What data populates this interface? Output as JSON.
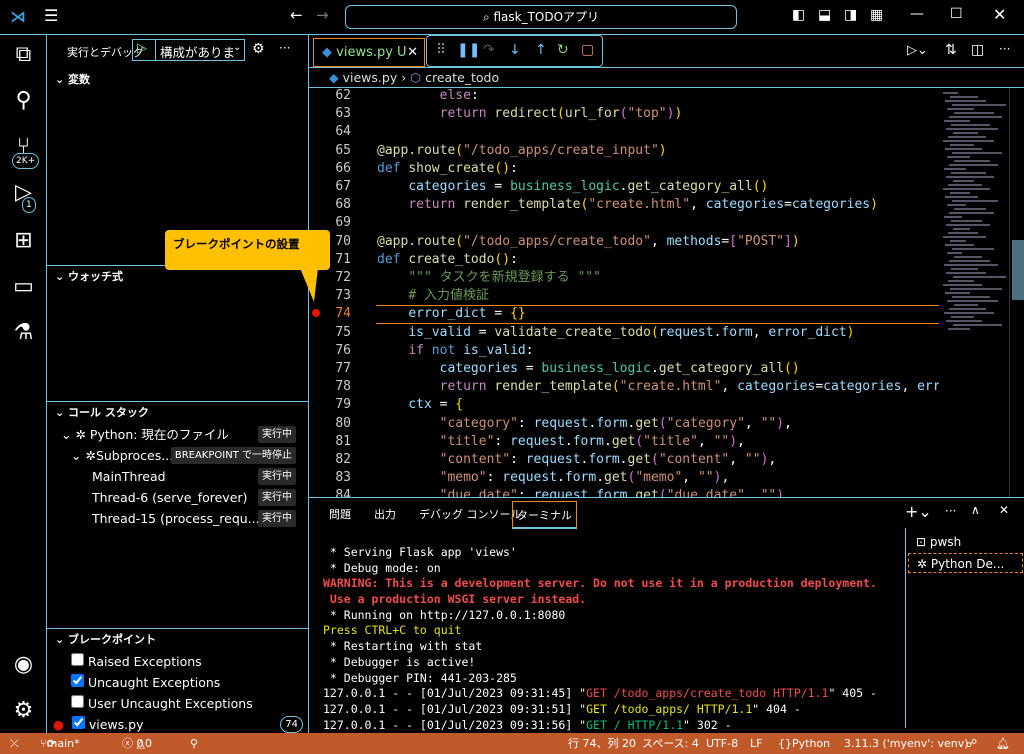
{
  "titlebar": {
    "search": "flask_TODOアプリ",
    "icons": [
      "vscode-logo",
      "menu-icon",
      "back-arrow-icon",
      "forward-arrow-icon",
      "toggle-sidebar-icon",
      "toggle-panel-icon",
      "toggle-secondary-icon",
      "layout-icon",
      "minimize-icon",
      "maximize-icon",
      "close-icon"
    ]
  },
  "activity": {
    "scm_badge": "2K+",
    "debug_badge": "1"
  },
  "sidebar": {
    "title": "実行とデバッグ",
    "config": "構成がありま",
    "sections": {
      "variables": "変数",
      "watch": "ウォッチ式",
      "callstack": "コール スタック",
      "breakpoints": "ブレークポイント"
    },
    "callstack": [
      {
        "label": "Python: 現在のファイル",
        "status": "実行中"
      },
      {
        "label": "Subproces...",
        "status": "BREAKPOINT で一時停止"
      },
      {
        "label": "MainThread",
        "status": "実行中"
      },
      {
        "label": "Thread-6 (serve_forever)",
        "status": "実行中"
      },
      {
        "label": "Thread-15 (process_requ...",
        "status": "実行中"
      }
    ],
    "breakpoints": [
      {
        "label": "Raised Exceptions",
        "checked": false
      },
      {
        "label": "Uncaught Exceptions",
        "checked": true
      },
      {
        "label": "User Uncaught Exceptions",
        "checked": false
      },
      {
        "label": "views.py",
        "checked": true,
        "line": "74"
      }
    ]
  },
  "editor": {
    "tab": "views.py U",
    "breadcrumb_file": "views.py",
    "breadcrumb_symbol": "create_todo",
    "lines": [
      {
        "n": "62",
        "t": [
          [
            "        ",
            "pl"
          ],
          [
            "else",
            "rt"
          ],
          [
            ":",
            "pl"
          ]
        ]
      },
      {
        "n": "63",
        "t": [
          [
            "        ",
            "pl"
          ],
          [
            "return",
            "rt"
          ],
          [
            " ",
            "pl"
          ],
          [
            "redirect",
            "fn"
          ],
          [
            "(",
            "b1"
          ],
          [
            "url_for",
            "fn"
          ],
          [
            "(",
            "b2"
          ],
          [
            "\"top\"",
            "st"
          ],
          [
            ")",
            "b2"
          ],
          [
            ")",
            "b1"
          ]
        ]
      },
      {
        "n": "64",
        "t": []
      },
      {
        "n": "65",
        "t": [
          [
            "@app.route",
            "fn"
          ],
          [
            "(",
            "b1"
          ],
          [
            "\"/todo_apps/create_input\"",
            "st"
          ],
          [
            ")",
            "b1"
          ]
        ]
      },
      {
        "n": "66",
        "t": [
          [
            "def",
            "kw"
          ],
          [
            " ",
            "pl"
          ],
          [
            "show_create",
            "fn"
          ],
          [
            "()",
            "b1"
          ],
          [
            ":",
            "pl"
          ]
        ]
      },
      {
        "n": "67",
        "t": [
          [
            "    ",
            "pl"
          ],
          [
            "categories",
            "va"
          ],
          [
            " = ",
            "pl"
          ],
          [
            "business_logic",
            "mo"
          ],
          [
            ".",
            "pl"
          ],
          [
            "get_category_all",
            "fn"
          ],
          [
            "()",
            "b1"
          ]
        ]
      },
      {
        "n": "68",
        "t": [
          [
            "    ",
            "pl"
          ],
          [
            "return",
            "rt"
          ],
          [
            " ",
            "pl"
          ],
          [
            "render_template",
            "fn"
          ],
          [
            "(",
            "b1"
          ],
          [
            "\"create.html\"",
            "st"
          ],
          [
            ", ",
            "pl"
          ],
          [
            "categories",
            "va"
          ],
          [
            "=",
            "pl"
          ],
          [
            "categories",
            "va"
          ],
          [
            ")",
            "b1"
          ]
        ]
      },
      {
        "n": "69",
        "t": []
      },
      {
        "n": "70",
        "t": [
          [
            "@app.route",
            "fn"
          ],
          [
            "(",
            "b1"
          ],
          [
            "\"/todo_apps/create_todo\"",
            "st"
          ],
          [
            ", ",
            "pl"
          ],
          [
            "methods",
            "va"
          ],
          [
            "=",
            "pl"
          ],
          [
            "[",
            "b2"
          ],
          [
            "\"POST\"",
            "st"
          ],
          [
            "]",
            "b2"
          ],
          [
            ")",
            "b1"
          ]
        ]
      },
      {
        "n": "71",
        "t": [
          [
            "def",
            "kw"
          ],
          [
            " ",
            "pl"
          ],
          [
            "create_todo",
            "fn"
          ],
          [
            "()",
            "b1"
          ],
          [
            ":",
            "pl"
          ]
        ]
      },
      {
        "n": "72",
        "t": [
          [
            "    ",
            "pl"
          ],
          [
            "\"\"\" タスクを新規登録する \"\"\"",
            "cm"
          ]
        ]
      },
      {
        "n": "73",
        "t": [
          [
            "    ",
            "pl"
          ],
          [
            "# 入力値検証",
            "cm"
          ]
        ]
      },
      {
        "n": "74",
        "t": [
          [
            "    ",
            "pl"
          ],
          [
            "error_dict",
            "va"
          ],
          [
            " = ",
            "pl"
          ],
          [
            "{}",
            "b1"
          ]
        ]
      },
      {
        "n": "75",
        "t": [
          [
            "    ",
            "pl"
          ],
          [
            "is_valid",
            "va"
          ],
          [
            " = ",
            "pl"
          ],
          [
            "validate_create_todo",
            "fn"
          ],
          [
            "(",
            "b1"
          ],
          [
            "request",
            "va"
          ],
          [
            ".",
            "pl"
          ],
          [
            "form",
            "va"
          ],
          [
            ", ",
            "pl"
          ],
          [
            "error_dict",
            "va"
          ],
          [
            ")",
            "b1"
          ]
        ]
      },
      {
        "n": "76",
        "t": [
          [
            "    ",
            "pl"
          ],
          [
            "if",
            "rt"
          ],
          [
            " ",
            "pl"
          ],
          [
            "not",
            "kw"
          ],
          [
            " ",
            "pl"
          ],
          [
            "is_valid",
            "va"
          ],
          [
            ":",
            "pl"
          ]
        ]
      },
      {
        "n": "77",
        "t": [
          [
            "        ",
            "pl"
          ],
          [
            "categories",
            "va"
          ],
          [
            " = ",
            "pl"
          ],
          [
            "business_logic",
            "mo"
          ],
          [
            ".",
            "pl"
          ],
          [
            "get_category_all",
            "fn"
          ],
          [
            "()",
            "b1"
          ]
        ]
      },
      {
        "n": "78",
        "t": [
          [
            "        ",
            "pl"
          ],
          [
            "return",
            "rt"
          ],
          [
            " ",
            "pl"
          ],
          [
            "render_template",
            "fn"
          ],
          [
            "(",
            "b1"
          ],
          [
            "\"create.html\"",
            "st"
          ],
          [
            ", ",
            "pl"
          ],
          [
            "categories",
            "va"
          ],
          [
            "=",
            "pl"
          ],
          [
            "categories",
            "va"
          ],
          [
            ", ",
            "pl"
          ],
          [
            "error",
            "va"
          ]
        ]
      },
      {
        "n": "79",
        "t": [
          [
            "    ",
            "pl"
          ],
          [
            "ctx",
            "va"
          ],
          [
            " = ",
            "pl"
          ],
          [
            "{",
            "b1"
          ]
        ]
      },
      {
        "n": "80",
        "t": [
          [
            "        ",
            "pl"
          ],
          [
            "\"category\"",
            "st"
          ],
          [
            ": ",
            "pl"
          ],
          [
            "request",
            "va"
          ],
          [
            ".",
            "pl"
          ],
          [
            "form",
            "va"
          ],
          [
            ".",
            "pl"
          ],
          [
            "get",
            "fn"
          ],
          [
            "(",
            "b2"
          ],
          [
            "\"category\"",
            "st"
          ],
          [
            ", ",
            "pl"
          ],
          [
            "\"\"",
            "st"
          ],
          [
            ")",
            "b2"
          ],
          [
            ",",
            "pl"
          ]
        ]
      },
      {
        "n": "81",
        "t": [
          [
            "        ",
            "pl"
          ],
          [
            "\"title\"",
            "st"
          ],
          [
            ": ",
            "pl"
          ],
          [
            "request",
            "va"
          ],
          [
            ".",
            "pl"
          ],
          [
            "form",
            "va"
          ],
          [
            ".",
            "pl"
          ],
          [
            "get",
            "fn"
          ],
          [
            "(",
            "b2"
          ],
          [
            "\"title\"",
            "st"
          ],
          [
            ", ",
            "pl"
          ],
          [
            "\"\"",
            "st"
          ],
          [
            ")",
            "b2"
          ],
          [
            ",",
            "pl"
          ]
        ]
      },
      {
        "n": "82",
        "t": [
          [
            "        ",
            "pl"
          ],
          [
            "\"content\"",
            "st"
          ],
          [
            ": ",
            "pl"
          ],
          [
            "request",
            "va"
          ],
          [
            ".",
            "pl"
          ],
          [
            "form",
            "va"
          ],
          [
            ".",
            "pl"
          ],
          [
            "get",
            "fn"
          ],
          [
            "(",
            "b2"
          ],
          [
            "\"content\"",
            "st"
          ],
          [
            ", ",
            "pl"
          ],
          [
            "\"\"",
            "st"
          ],
          [
            ")",
            "b2"
          ],
          [
            ",",
            "pl"
          ]
        ]
      },
      {
        "n": "83",
        "t": [
          [
            "        ",
            "pl"
          ],
          [
            "\"memo\"",
            "st"
          ],
          [
            ": ",
            "pl"
          ],
          [
            "request",
            "va"
          ],
          [
            ".",
            "pl"
          ],
          [
            "form",
            "va"
          ],
          [
            ".",
            "pl"
          ],
          [
            "get",
            "fn"
          ],
          [
            "(",
            "b2"
          ],
          [
            "\"memo\"",
            "st"
          ],
          [
            ", ",
            "pl"
          ],
          [
            "\"\"",
            "st"
          ],
          [
            ")",
            "b2"
          ],
          [
            ",",
            "pl"
          ]
        ]
      },
      {
        "n": "84",
        "t": [
          [
            "        ",
            "pl"
          ],
          [
            "\"due_date\"",
            "st"
          ],
          [
            ": ",
            "pl"
          ],
          [
            "request",
            "va"
          ],
          [
            ".",
            "pl"
          ],
          [
            "form",
            "va"
          ],
          [
            ".",
            "pl"
          ],
          [
            "get",
            "fn"
          ],
          [
            "(",
            "b2"
          ],
          [
            "\"due_date\"",
            "st"
          ],
          [
            ", ",
            "pl"
          ],
          [
            "\"\"",
            "st"
          ],
          [
            ")",
            "b2"
          ],
          [
            ",",
            "pl"
          ]
        ]
      }
    ],
    "current_line": "74",
    "breakpoint_line": "74"
  },
  "callout": "ブレークポイントの設置",
  "panel": {
    "tabs": [
      "問題",
      "出力",
      "デバッグ コンソール",
      "ターミナル"
    ],
    "active_tab": "ターミナル",
    "terminals": [
      "pwsh",
      "Python De..."
    ],
    "terminal": [
      [
        [
          " * Serving Flask app 'views'",
          "pl"
        ]
      ],
      [
        [
          " * Debug mode: on",
          "pl"
        ]
      ],
      [
        [
          "WARNING: This is a development server. Do not use it in a production deployment.",
          "red"
        ]
      ],
      [
        [
          " Use a production WSGI server instead.",
          "red"
        ]
      ],
      [
        [
          " * Running on http://127.0.0.1:8080",
          "pl"
        ]
      ],
      [
        [
          "Press CTRL+C to quit",
          "yel"
        ]
      ],
      [
        [
          " * Restarting with stat",
          "pl"
        ]
      ],
      [
        [
          " * Debugger is active!",
          "pl"
        ]
      ],
      [
        [
          " * Debugger PIN: 441-203-285",
          "pl"
        ]
      ],
      [
        [
          "127.0.0.1 - - [01/Jul/2023 09:31:45] \"",
          "pl"
        ],
        [
          "GET /todo_apps/create_todo HTTP/1.1",
          "tred"
        ],
        [
          "\" 405 -",
          "pl"
        ]
      ],
      [
        [
          "127.0.0.1 - - [01/Jul/2023 09:31:51] \"",
          "pl"
        ],
        [
          "GET /todo_apps/ HTTP/1.1",
          "yel"
        ],
        [
          "\" 404 -",
          "pl"
        ]
      ],
      [
        [
          "127.0.0.1 - - [01/Jul/2023 09:31:56] \"",
          "pl"
        ],
        [
          "GET / HTTP/1.1",
          "tgrn"
        ],
        [
          "\" 302 -",
          "pl"
        ]
      ]
    ]
  },
  "status": {
    "branch": "main*",
    "errors": "0",
    "warnings": "0",
    "position": "行 74、列 20",
    "spaces": "スペース: 4",
    "encoding": "UTF-8",
    "eol": "LF",
    "language": "Python",
    "interpreter": "3.11.3 ('myenv': venv)"
  },
  "colors": {
    "border": "#6fc3df",
    "focus": "#f38518",
    "statusbar": "#c05a2b",
    "callout": "#ffc000",
    "breakpoint": "#e51400"
  }
}
